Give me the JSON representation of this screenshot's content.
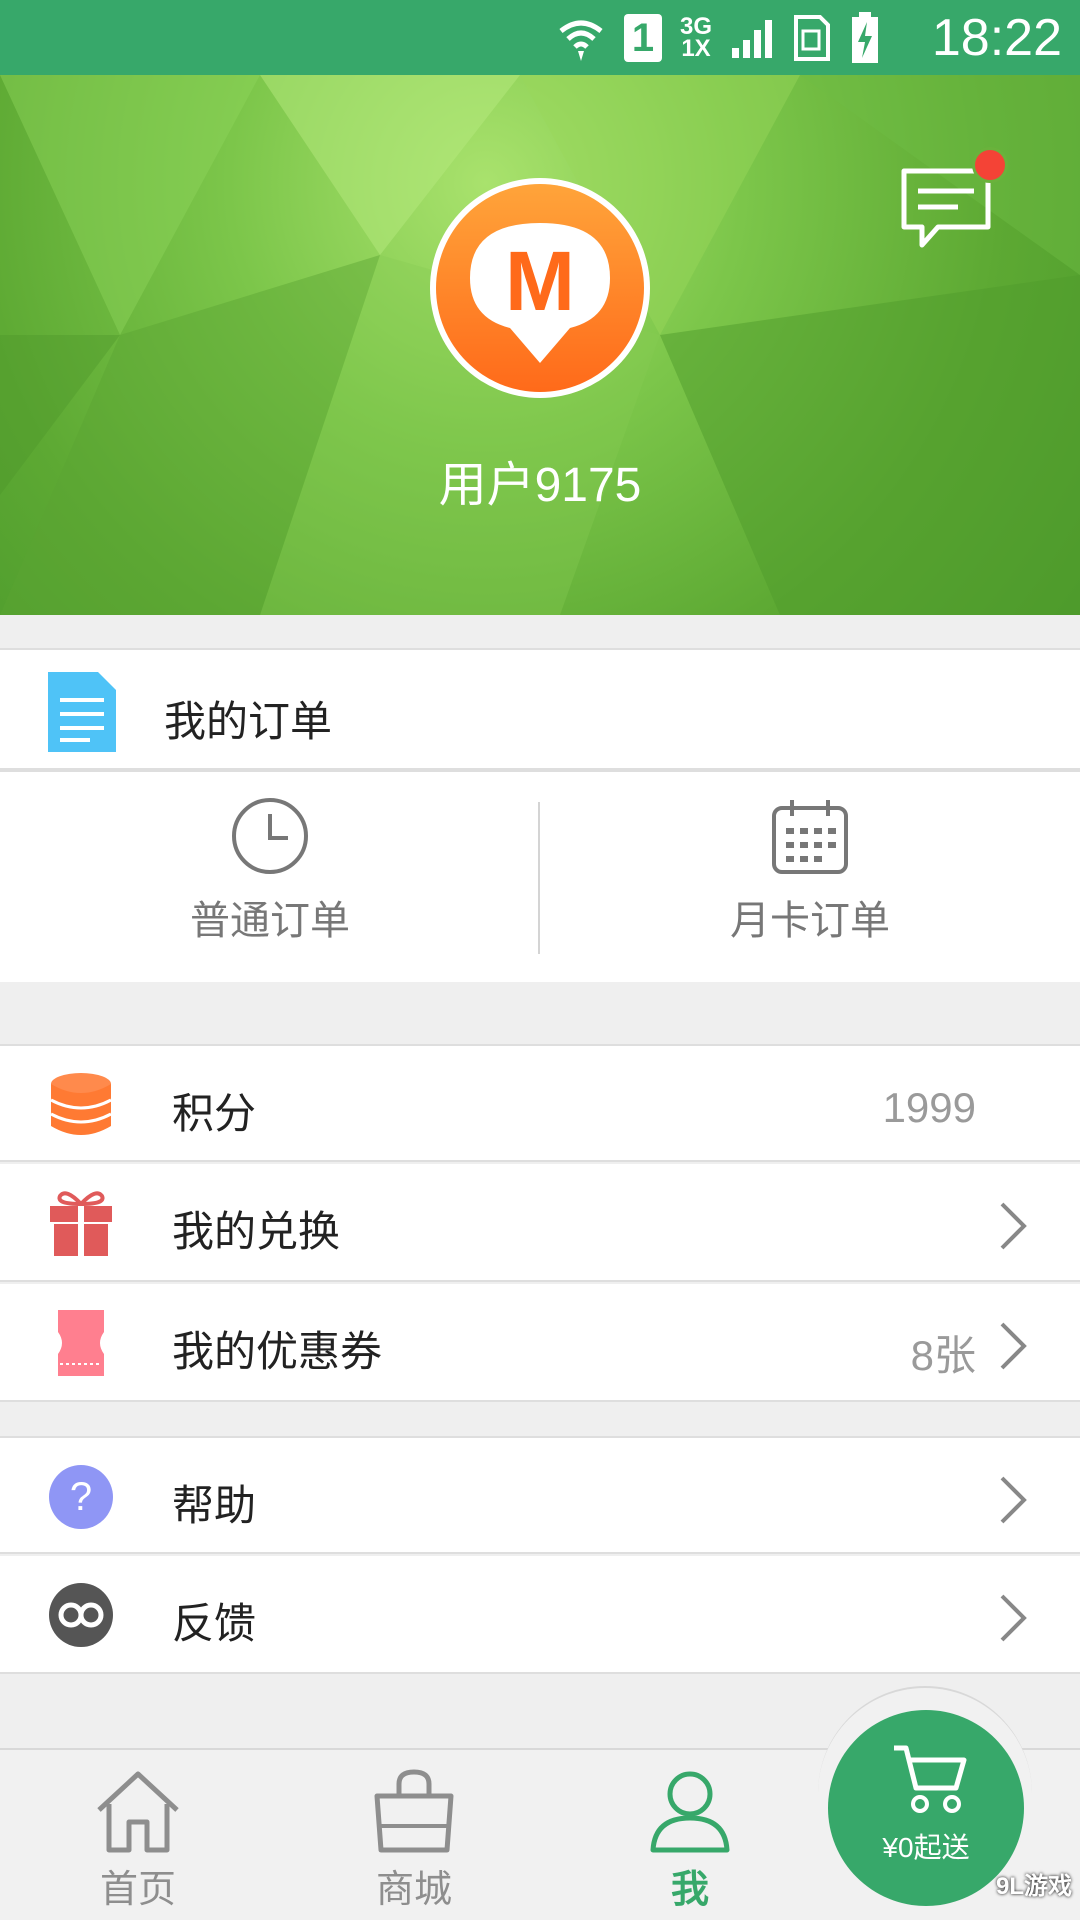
{
  "status_bar": {
    "time": "18:22",
    "sim": "1",
    "network_top": "3G",
    "network_bottom": "1X",
    "icons": [
      "wifi-icon",
      "sim-icon",
      "signal-icon",
      "sim-card-icon",
      "battery-charging-icon"
    ]
  },
  "profile": {
    "avatar_letter": "M",
    "username": "用户9175",
    "has_unread_messages": true
  },
  "orders": {
    "title": "我的订单",
    "types": [
      {
        "label": "普通订单",
        "icon": "clock-icon"
      },
      {
        "label": "月卡订单",
        "icon": "calendar-icon"
      }
    ]
  },
  "account_list": [
    {
      "label": "积分",
      "value": "1999",
      "icon": "coins-icon",
      "has_arrow": false
    },
    {
      "label": "我的兑换",
      "value": "",
      "icon": "gift-icon",
      "has_arrow": true
    },
    {
      "label": "我的优惠券",
      "value": "8张",
      "icon": "coupon-icon",
      "has_arrow": true
    }
  ],
  "support_list": [
    {
      "label": "帮助",
      "icon": "help-icon",
      "has_arrow": true
    },
    {
      "label": "反馈",
      "icon": "feedback-icon",
      "has_arrow": true
    }
  ],
  "bottom_nav": {
    "tabs": [
      {
        "label": "首页",
        "icon": "home-icon",
        "active": false
      },
      {
        "label": "商城",
        "icon": "shopping-bag-icon",
        "active": false
      },
      {
        "label": "我",
        "icon": "user-icon",
        "active": true
      }
    ],
    "cart_label": "¥0起送"
  },
  "watermark": "9L游戏",
  "colors": {
    "brand_green": "#37a86a",
    "accent_orange": "#ff7a2a",
    "badge_red": "#f44336"
  }
}
